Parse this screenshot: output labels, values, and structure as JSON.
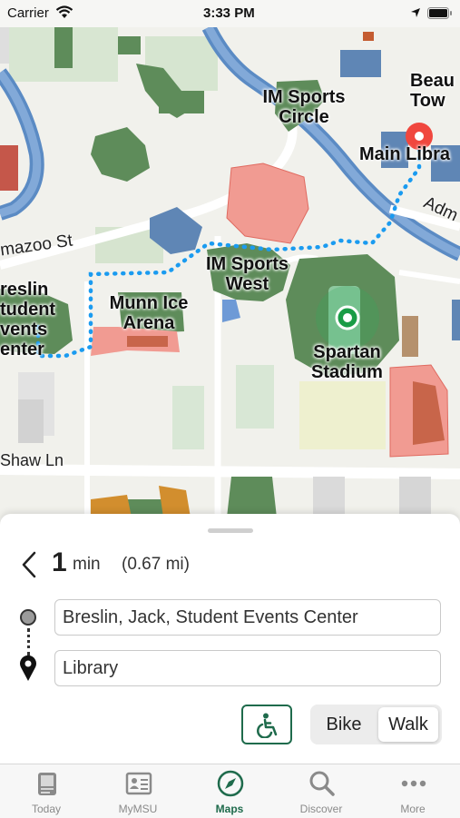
{
  "status_bar": {
    "carrier": "Carrier",
    "time": "3:33 PM"
  },
  "map": {
    "labels": {
      "im_sports_circle": "IM Sports Circle",
      "beau_tow": "Beau Tow",
      "main_library": "Main Libra",
      "adm": "Adm",
      "kalamazoo_st": "mazoo St",
      "im_sports_west": "IM Sports West",
      "breslin": "reslin tudent vents enter",
      "munn_ice_arena": "Munn Ice Arena",
      "spartan_stadium": "Spartan Stadium",
      "shaw_ln": "Shaw Ln"
    },
    "colors": {
      "route": "#1a9bf0",
      "building_green": "#5e8c5a",
      "building_blue": "#5f86b5",
      "restricted_red": "#f19b92",
      "destination_pin": "#f0473e",
      "origin_pin": "#1a9c46"
    }
  },
  "directions": {
    "duration_value": "1",
    "duration_unit": "min",
    "distance": "(0.67 mi)",
    "from": "Breslin, Jack, Student Events Center",
    "to": "Library",
    "modes": {
      "bike": "Bike",
      "walk": "Walk",
      "selected": "Walk"
    }
  },
  "tab_bar": {
    "today": "Today",
    "mymsu": "MyMSU",
    "maps": "Maps",
    "discover": "Discover",
    "more": "More",
    "active": "Maps",
    "accent": "#1f6b4c"
  }
}
